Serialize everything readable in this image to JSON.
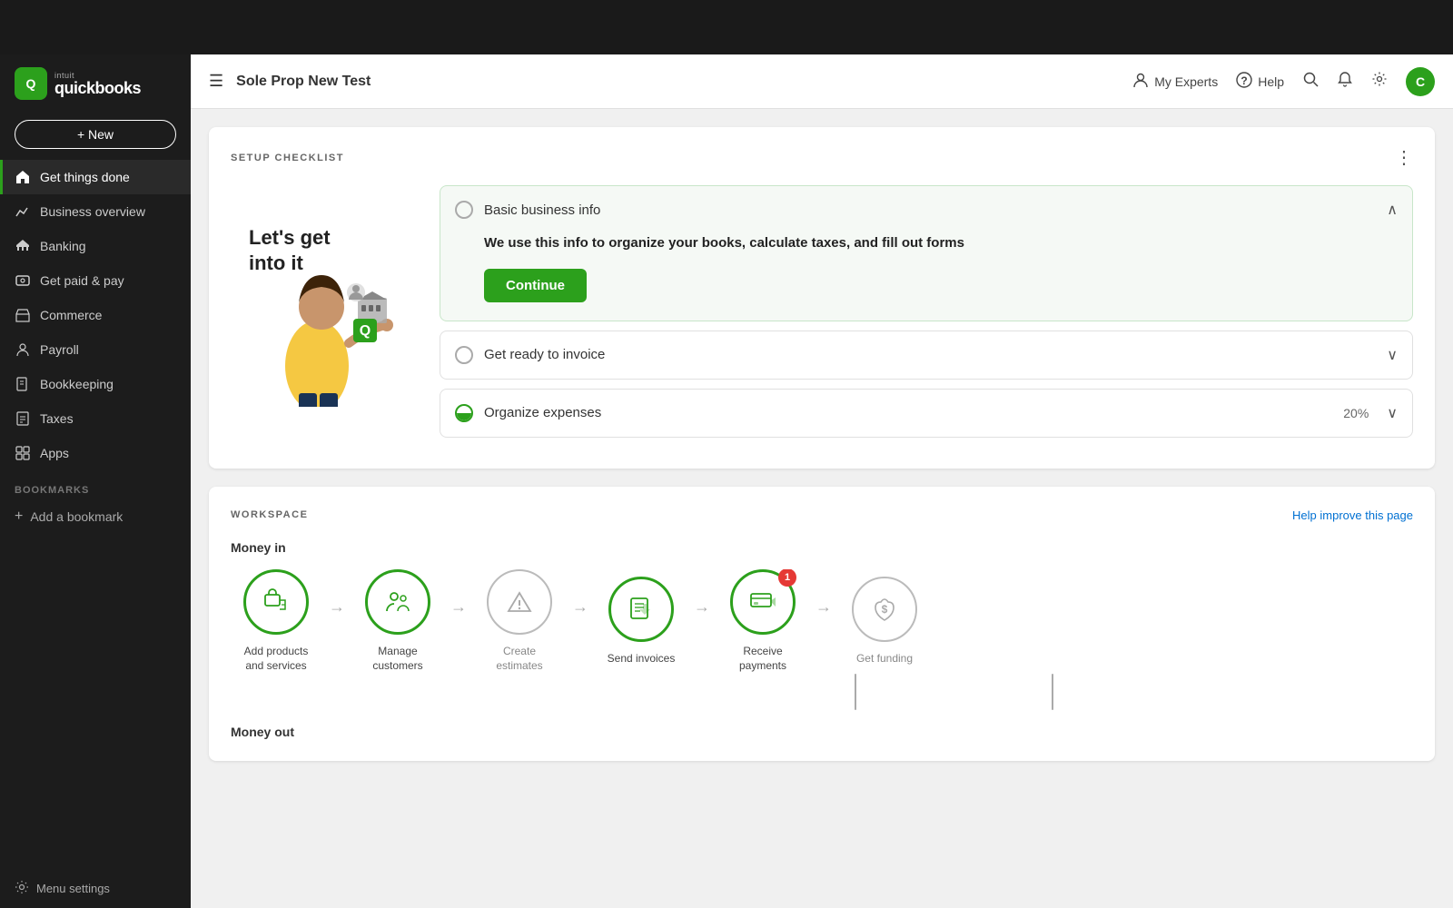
{
  "topbar": {
    "height": 60
  },
  "sidebar": {
    "logo": {
      "intuit": "intuit",
      "quickbooks": "quickbooks"
    },
    "new_button": "+ New",
    "nav_items": [
      {
        "id": "get-things-done",
        "label": "Get things done",
        "icon": "home",
        "active": true
      },
      {
        "id": "business-overview",
        "label": "Business overview",
        "icon": "chart"
      },
      {
        "id": "banking",
        "label": "Banking",
        "icon": "bank"
      },
      {
        "id": "get-paid-pay",
        "label": "Get paid & pay",
        "icon": "dollar"
      },
      {
        "id": "commerce",
        "label": "Commerce",
        "icon": "store"
      },
      {
        "id": "payroll",
        "label": "Payroll",
        "icon": "person"
      },
      {
        "id": "bookkeeping",
        "label": "Bookkeeping",
        "icon": "book"
      },
      {
        "id": "taxes",
        "label": "Taxes",
        "icon": "tax"
      },
      {
        "id": "apps",
        "label": "Apps",
        "icon": "grid"
      }
    ],
    "bookmarks_label": "BOOKMARKS",
    "add_bookmark": "Add a bookmark",
    "menu_settings": "Menu settings"
  },
  "header": {
    "title": "Sole Prop New Test",
    "my_experts": "My Experts",
    "help": "Help",
    "avatar_letter": "C"
  },
  "setup_checklist": {
    "section_label": "SETUP CHECKLIST",
    "heading": "Let's get into it",
    "items": [
      {
        "id": "basic-business-info",
        "label": "Basic business info",
        "expanded": true,
        "description": "We use this info to organize your books, calculate taxes, and fill out forms",
        "cta": "Continue",
        "percent": null
      },
      {
        "id": "get-ready-to-invoice",
        "label": "Get ready to invoice",
        "expanded": false,
        "description": "",
        "cta": null,
        "percent": null
      },
      {
        "id": "organize-expenses",
        "label": "Organize expenses",
        "expanded": false,
        "description": "",
        "cta": null,
        "percent": "20%"
      }
    ]
  },
  "workspace": {
    "section_label": "WORKSPACE",
    "help_link": "Help improve this page",
    "money_in_label": "Money in",
    "money_out_label": "Money out",
    "workflow_items": [
      {
        "id": "add-products",
        "label": "Add products\nand services",
        "icon": "products",
        "active": true,
        "badge": null,
        "grey": false
      },
      {
        "id": "manage-customers",
        "label": "Manage\ncustomers",
        "icon": "customers",
        "active": true,
        "badge": null,
        "grey": false
      },
      {
        "id": "create-estimates",
        "label": "Create\nestimates",
        "icon": "estimates",
        "active": false,
        "badge": null,
        "grey": true
      },
      {
        "id": "send-invoices",
        "label": "Send invoices",
        "icon": "invoices",
        "active": true,
        "badge": null,
        "grey": false
      },
      {
        "id": "receive-payments",
        "label": "Receive\npayments",
        "icon": "payments",
        "active": true,
        "badge": 1,
        "grey": false
      },
      {
        "id": "get-funding",
        "label": "Get funding",
        "icon": "funding",
        "active": false,
        "badge": null,
        "grey": true
      }
    ]
  }
}
